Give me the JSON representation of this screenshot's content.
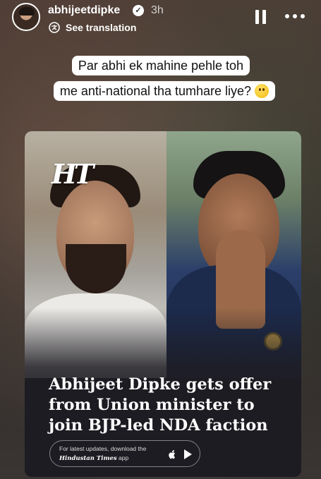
{
  "story": {
    "username": "abhijeetdipke",
    "time": "3h",
    "translate_label": "See translation"
  },
  "caption": {
    "line1": "Par abhi ek mahine pehle toh",
    "line2": "me anti-national tha tumhare liye?"
  },
  "card": {
    "logo": "HT",
    "headline_line1": "Abhijeet Dipke gets offer",
    "headline_line2": "from Union minister to",
    "headline_line3": "join BJP-led NDA faction",
    "promo_line1": "For latest updates, download the",
    "promo_brand": "Hindustan Times",
    "promo_suffix": " app"
  },
  "icons": [
    "verified-icon",
    "translate-icon",
    "pause-icon",
    "more-icon",
    "smile-emoji-icon",
    "apple-icon",
    "play-store-icon"
  ]
}
